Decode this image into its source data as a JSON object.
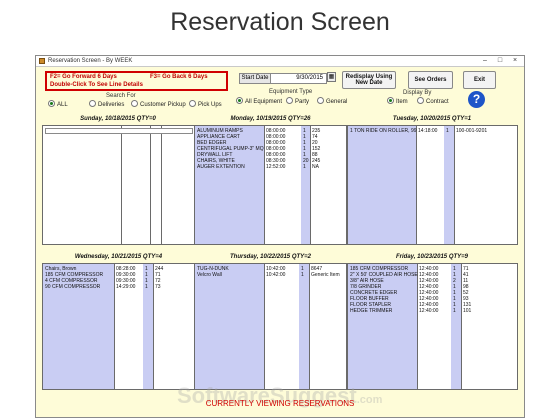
{
  "page_heading": "Reservation Screen",
  "window": {
    "title": "Reservation Screen - By WEEK",
    "controls": {
      "minimize": "–",
      "maximize": "□",
      "close": "×"
    }
  },
  "notice": {
    "forward": "F2= Go Forward 6 Days",
    "back": "F3= Go Back 6 Days",
    "detail": "Double-Click To See Line Details"
  },
  "search_for": {
    "label": "Search For",
    "options": [
      "ALL",
      "Deliveries",
      "Customer Pickup",
      "Pick Ups"
    ],
    "selected": "ALL"
  },
  "start_date": {
    "label": "Start Date",
    "value": "9/30/2015"
  },
  "equipment_type": {
    "label": "Equipment Type",
    "options": [
      "All Equipment",
      "Party",
      "General"
    ],
    "selected": "All Equipment"
  },
  "display_by": {
    "label": "Display By",
    "options": [
      "Item",
      "Contract"
    ],
    "selected": "Item"
  },
  "buttons": {
    "redisplay_line1": "Redisplay Using",
    "redisplay_line2": "New Date",
    "see_orders": "See Orders",
    "exit": "Exit",
    "help": "?"
  },
  "days": [
    {
      "header": "Sunday, 10/18/2015 QTY=0",
      "rows": []
    },
    {
      "header": "Monday, 10/19/2015 QTY=26",
      "rows": [
        {
          "item": "ALUMINUM RAMPS",
          "time": "08:00:00",
          "qty": "1",
          "ref": "235"
        },
        {
          "item": "APPLIANCE CART",
          "time": "08:00:00",
          "qty": "1",
          "ref": "74"
        },
        {
          "item": "BED EDGER",
          "time": "08:00:00",
          "qty": "1",
          "ref": "20"
        },
        {
          "item": "CENTRIFUGAL PUMP-3\" MQ",
          "time": "08:00:00",
          "qty": "1",
          "ref": "152"
        },
        {
          "item": "DRYWALL LIFT",
          "time": "08:00:00",
          "qty": "1",
          "ref": "88"
        },
        {
          "item": "CHAIRS, WHITE",
          "time": "08:30:00",
          "qty": "20",
          "ref": "245"
        },
        {
          "item": "AUGER EXTENTION",
          "time": "12:52:00",
          "qty": "1",
          "ref": "NA"
        }
      ]
    },
    {
      "header": "Tuesday, 10/20/2015 QTY=1",
      "rows": [
        {
          "item": "1 TON RIDE ON ROLLER, 99",
          "time": "14:18:00",
          "qty": "1",
          "ref": "100-001-9201"
        }
      ]
    },
    {
      "header": "Wednesday, 10/21/2015 QTY=4",
      "rows": [
        {
          "item": "Chairs, Brown",
          "time": "08:28:00",
          "qty": "1",
          "ref": "244"
        },
        {
          "item": "185 CFM COMPRESSOR",
          "time": "09:30:00",
          "qty": "1",
          "ref": "71"
        },
        {
          "item": "4 CFM COMPRESSOR",
          "time": "09:30:00",
          "qty": "1",
          "ref": "72"
        },
        {
          "item": "90 CFM COMPRESSOR",
          "time": "14:29:00",
          "qty": "1",
          "ref": "73"
        }
      ]
    },
    {
      "header": "Thursday, 10/22/2015 QTY=2",
      "rows": [
        {
          "item": "TUG-N-DUNK",
          "time": "10:42:00",
          "qty": "1",
          "ref": "8647"
        },
        {
          "item": "Velcro Wall",
          "time": "10:42:00",
          "qty": "1",
          "ref": "Generic Item"
        }
      ]
    },
    {
      "header": "Friday, 10/23/2015 QTY=9",
      "rows": [
        {
          "item": "185 CFM COMPRESSOR",
          "time": "12:40:00",
          "qty": "1",
          "ref": "71"
        },
        {
          "item": "2\" X 50' COUPLED AIR HOSE",
          "time": "12:40:00",
          "qty": "1",
          "ref": "41"
        },
        {
          "item": "3/8\" AIR HOSE",
          "time": "12:40:00",
          "qty": "2",
          "ref": "11"
        },
        {
          "item": "7/8 GRINDER",
          "time": "12:40:00",
          "qty": "1",
          "ref": "98"
        },
        {
          "item": "CONCRETE EDGER",
          "time": "12:40:00",
          "qty": "1",
          "ref": "52"
        },
        {
          "item": "FLOOR BUFFER",
          "time": "12:40:00",
          "qty": "1",
          "ref": "93"
        },
        {
          "item": "FLOOR STAPLER",
          "time": "12:40:00",
          "qty": "1",
          "ref": "131"
        },
        {
          "item": "HEDGE TRIMMER",
          "time": "12:40:00",
          "qty": "1",
          "ref": "101"
        }
      ]
    }
  ],
  "status": "CURRENTLY VIEWING RESERVATIONS",
  "watermark": {
    "main": "SoftwareSuggest",
    "suffix": ".com"
  },
  "colors": {
    "window_bg": "#fefcd8",
    "shade": "#c9cdf3",
    "alert": "#d00000",
    "help": "#1e55c8"
  }
}
